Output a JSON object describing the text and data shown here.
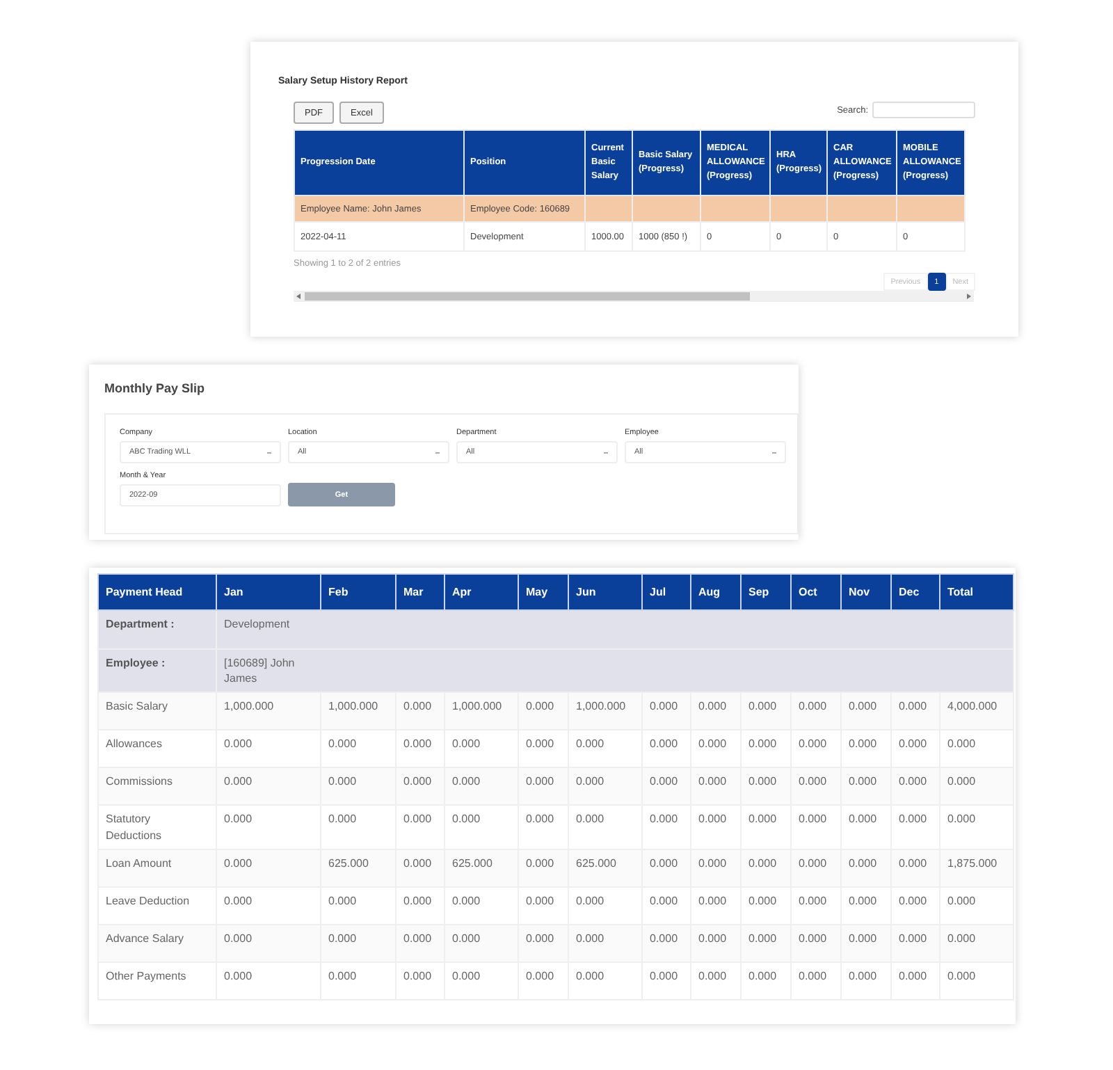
{
  "history_report": {
    "title": "Salary Setup History Report",
    "export_buttons": [
      "PDF",
      "Excel"
    ],
    "search": {
      "label": "Search:"
    },
    "columns": [
      "Progression Date",
      "Position",
      "Current Basic Salary",
      "Basic Salary (Progress)",
      "MEDICAL ALLOWANCE (Progress)",
      "HRA (Progress)",
      "CAR ALLOWANCE (Progress)",
      "MOBILE ALLOWANCE (Progress)"
    ],
    "group_row": [
      "Employee Name: John James",
      "Employee Code: 160689"
    ],
    "rows": [
      [
        "2022-04-11",
        "Development",
        "1000.00",
        "1000 (850 !)",
        "0",
        "0",
        "0",
        "0"
      ]
    ],
    "info": "Showing 1 to 2 of 2 entries",
    "pagination": [
      {
        "label": "Previous",
        "selected": false
      },
      {
        "label": "1",
        "selected": true
      },
      {
        "label": "Next",
        "selected": false
      }
    ]
  },
  "pay_slip": {
    "title": "Monthly Pay Slip",
    "filters": [
      {
        "label": "Company",
        "value": "ABC Trading WLL",
        "kind": "select"
      },
      {
        "label": "Location",
        "value": "All",
        "kind": "select"
      },
      {
        "label": "Department",
        "value": "All",
        "kind": "select"
      },
      {
        "label": "Employee",
        "value": "All",
        "kind": "select"
      },
      {
        "label": "Month & Year",
        "value": "2022-09",
        "kind": "input"
      }
    ],
    "get_button": "Get"
  },
  "pay_table": {
    "columns": [
      "Payment Head",
      "Jan",
      "Feb",
      "Mar",
      "Apr",
      "May",
      "Jun",
      "Jul",
      "Aug",
      "Sep",
      "Oct",
      "Nov",
      "Dec",
      "Total"
    ],
    "groups": [
      {
        "label": "Department :",
        "value": "Development"
      },
      {
        "label": "Employee :",
        "value": "[160689] John James"
      }
    ],
    "rows": [
      {
        "head": "Basic Salary",
        "values": [
          "1,000.000",
          "1,000.000",
          "0.000",
          "1,000.000",
          "0.000",
          "1,000.000",
          "0.000",
          "0.000",
          "0.000",
          "0.000",
          "0.000",
          "0.000",
          "4,000.000"
        ]
      },
      {
        "head": "Allowances",
        "values": [
          "0.000",
          "0.000",
          "0.000",
          "0.000",
          "0.000",
          "0.000",
          "0.000",
          "0.000",
          "0.000",
          "0.000",
          "0.000",
          "0.000",
          "0.000"
        ]
      },
      {
        "head": "Commissions",
        "values": [
          "0.000",
          "0.000",
          "0.000",
          "0.000",
          "0.000",
          "0.000",
          "0.000",
          "0.000",
          "0.000",
          "0.000",
          "0.000",
          "0.000",
          "0.000"
        ]
      },
      {
        "head": "Statutory Deductions",
        "values": [
          "0.000",
          "0.000",
          "0.000",
          "0.000",
          "0.000",
          "0.000",
          "0.000",
          "0.000",
          "0.000",
          "0.000",
          "0.000",
          "0.000",
          "0.000"
        ]
      },
      {
        "head": "Loan Amount",
        "values": [
          "0.000",
          "625.000",
          "0.000",
          "625.000",
          "0.000",
          "625.000",
          "0.000",
          "0.000",
          "0.000",
          "0.000",
          "0.000",
          "0.000",
          "1,875.000"
        ]
      },
      {
        "head": "Leave Deduction",
        "values": [
          "0.000",
          "0.000",
          "0.000",
          "0.000",
          "0.000",
          "0.000",
          "0.000",
          "0.000",
          "0.000",
          "0.000",
          "0.000",
          "0.000",
          "0.000"
        ]
      },
      {
        "head": "Advance Salary",
        "values": [
          "0.000",
          "0.000",
          "0.000",
          "0.000",
          "0.000",
          "0.000",
          "0.000",
          "0.000",
          "0.000",
          "0.000",
          "0.000",
          "0.000",
          "0.000"
        ]
      },
      {
        "head": "Other Payments",
        "values": [
          "0.000",
          "0.000",
          "0.000",
          "0.000",
          "0.000",
          "0.000",
          "0.000",
          "0.000",
          "0.000",
          "0.000",
          "0.000",
          "0.000",
          "0.000"
        ]
      }
    ]
  }
}
